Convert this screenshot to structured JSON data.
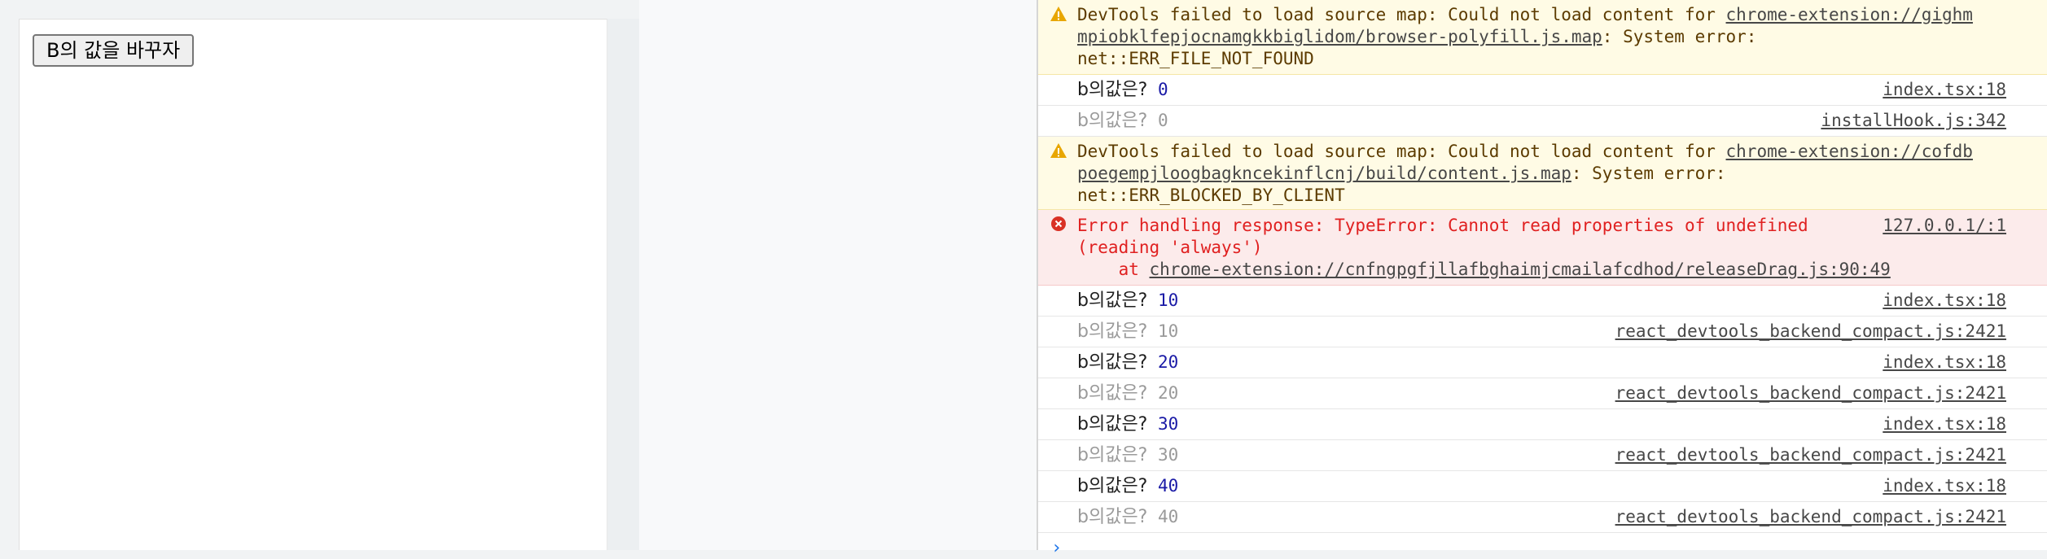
{
  "app": {
    "button_label": "B의 값을 바꾸자"
  },
  "console": {
    "rows": [
      {
        "type": "warning",
        "text_before": "DevTools failed to load source map: Could not load content for ",
        "link_line1": "chrome-extension://gighm",
        "link_line2": "mpiobklfepjocnamgkkbiglidom/browser-polyfill.js.map",
        "text_after": ": System error:",
        "text_line3": "net::ERR_FILE_NOT_FOUND"
      },
      {
        "type": "log",
        "label": "b의값은?",
        "value": "0",
        "source": "index.tsx:18"
      },
      {
        "type": "log-dim",
        "label": "b의값은?",
        "value": "0",
        "source": "installHook.js:342"
      },
      {
        "type": "warning",
        "text_before": "DevTools failed to load source map: Could not load content for ",
        "link_line1": "chrome-extension://cofdb",
        "link_line2": "poegempjloogbagkncekinflcnj/build/content.js.map",
        "text_after": ": System error:",
        "text_line3": "net::ERR_BLOCKED_BY_CLIENT"
      },
      {
        "type": "error",
        "line1": "Error handling response: TypeError: Cannot read properties of undefined",
        "line2": "(reading 'always')",
        "line3_prefix": "    at ",
        "line3_link": "chrome-extension://cnfngpgfjllafbghaimjcmailafcdhod/releaseDrag.js:90:49",
        "source": "127.0.0.1/:1"
      },
      {
        "type": "log",
        "label": "b의값은?",
        "value": "10",
        "source": "index.tsx:18"
      },
      {
        "type": "log-dim",
        "label": "b의값은?",
        "value": "10",
        "source": "react_devtools_backend_compact.js:2421"
      },
      {
        "type": "log",
        "label": "b의값은?",
        "value": "20",
        "source": "index.tsx:18"
      },
      {
        "type": "log-dim",
        "label": "b의값은?",
        "value": "20",
        "source": "react_devtools_backend_compact.js:2421"
      },
      {
        "type": "log",
        "label": "b의값은?",
        "value": "30",
        "source": "index.tsx:18"
      },
      {
        "type": "log-dim",
        "label": "b의값은?",
        "value": "30",
        "source": "react_devtools_backend_compact.js:2421"
      },
      {
        "type": "log",
        "label": "b의값은?",
        "value": "40",
        "source": "index.tsx:18"
      },
      {
        "type": "log-dim",
        "label": "b의값은?",
        "value": "40",
        "source": "react_devtools_backend_compact.js:2421"
      }
    ],
    "prompt": "›"
  },
  "colors": {
    "warning_bg": "#fffbe5",
    "error_bg": "#fcebeb",
    "error_text": "#e02020",
    "log_value": "#1a1aa6"
  },
  "icons": {
    "warning": "warning-triangle-icon",
    "error": "error-circle-icon"
  }
}
